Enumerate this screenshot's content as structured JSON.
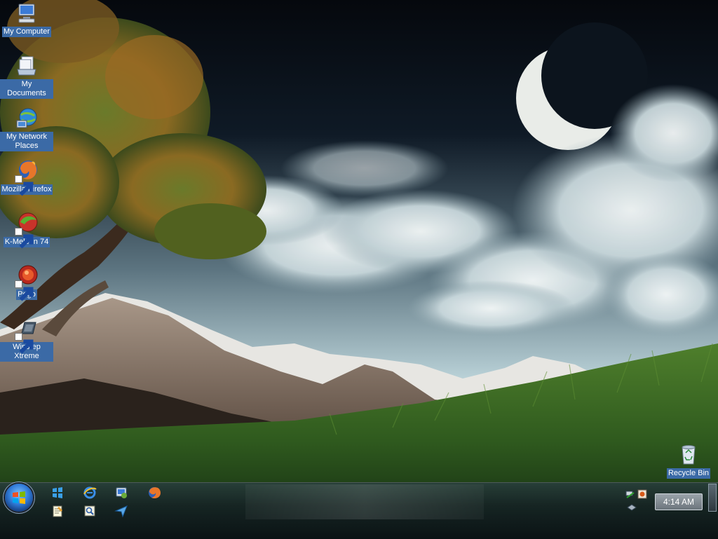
{
  "desktop": {
    "icons": [
      {
        "label": "My Computer",
        "icon": "computer-icon"
      },
      {
        "label": "My Documents",
        "icon": "documents-icon"
      },
      {
        "label": "My Network Places",
        "icon": "network-icon"
      },
      {
        "label": "Mozilla Firefox",
        "icon": "firefox-icon"
      },
      {
        "label": "K-Meleon 74",
        "icon": "kmeleon-icon"
      },
      {
        "label": "Pego",
        "icon": "pego-icon"
      },
      {
        "label": "Winstep Xtreme",
        "icon": "winstep-icon"
      },
      {
        "label": "Recycle Bin",
        "icon": "recycle-bin-icon"
      }
    ]
  },
  "taskbar": {
    "start_button": {
      "icon": "windows-logo-icon"
    },
    "quick_launch": [
      {
        "icon": "windows-flag-icon"
      },
      {
        "icon": "internet-explorer-icon"
      },
      {
        "icon": "network-app-icon"
      },
      {
        "icon": "firefox-icon"
      },
      {
        "icon": "notepad-icon"
      },
      {
        "icon": "search-window-icon"
      },
      {
        "icon": "send-arrow-icon"
      }
    ],
    "tray": {
      "icons": [
        "network-status-icon",
        "speaker-icon",
        "safely-remove-icon"
      ],
      "clock": "4:14 AM"
    },
    "show_desktop": {
      "icon": "show-desktop-icon"
    }
  },
  "colors": {
    "label_highlight": "#3b6aa6",
    "sky_dark": "#0a0f17",
    "grass": "#2f5a1e"
  }
}
